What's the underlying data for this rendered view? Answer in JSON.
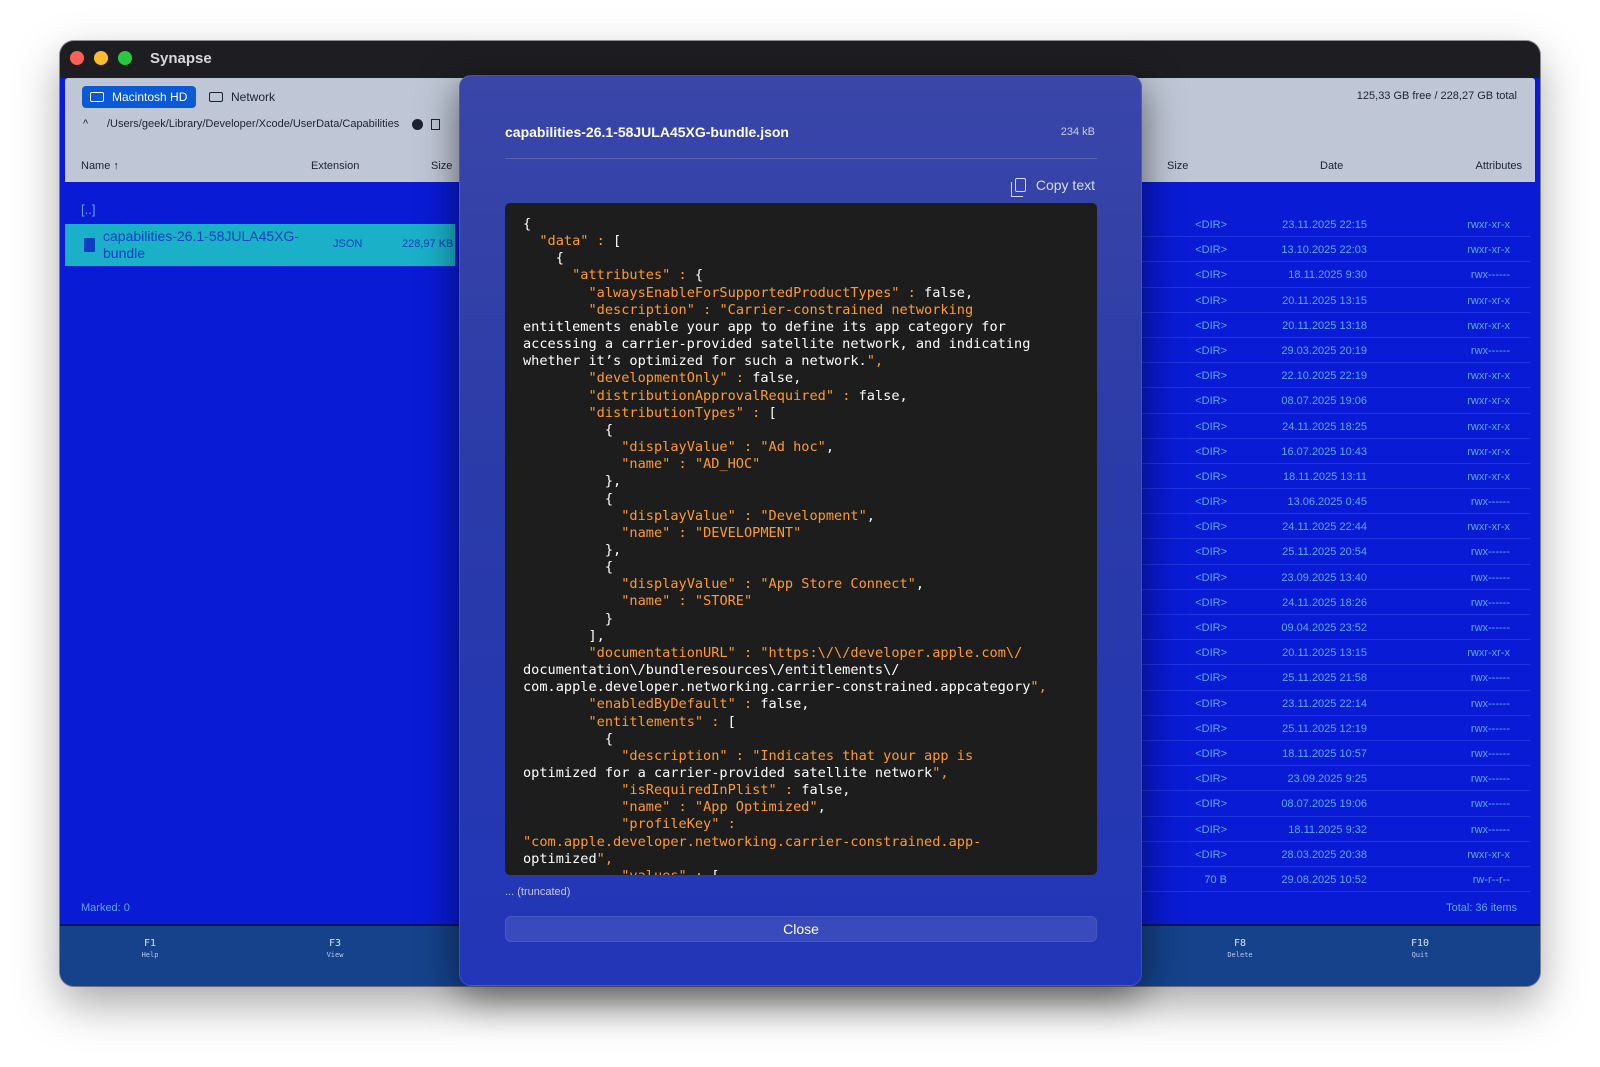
{
  "app": {
    "title": "Synapse"
  },
  "toolbar": {
    "volumes": [
      {
        "label": "Macintosh HD",
        "icon": "drive-icon"
      },
      {
        "label": "Network",
        "icon": "network-icon"
      }
    ],
    "free_space": "125,33 GB free / 228,27 GB total",
    "path": "/Users/geek/Library/Developer/Xcode/UserData/Capabilities"
  },
  "left_panel": {
    "columns": {
      "name": "Name ↑",
      "extension": "Extension",
      "size": "Size"
    },
    "parent": "[..]",
    "selected_file": {
      "name": "capabilities-26.1-58JULA45XG-bundle",
      "extension": "JSON",
      "size": "228,97 KB"
    },
    "marked": "Marked: 0"
  },
  "right_panel": {
    "columns": {
      "size": "Size",
      "date": "Date",
      "attributes": "Attributes"
    },
    "rows": [
      {
        "size": "<DIR>",
        "date": "23.11.2025 22:15",
        "attr": "rwxr-xr-x"
      },
      {
        "size": "<DIR>",
        "date": "13.10.2025 22:03",
        "attr": "rwxr-xr-x"
      },
      {
        "size": "<DIR>",
        "date": "18.11.2025 9:30",
        "attr": "rwx------"
      },
      {
        "size": "<DIR>",
        "date": "20.11.2025 13:15",
        "attr": "rwxr-xr-x"
      },
      {
        "size": "<DIR>",
        "date": "20.11.2025 13:18",
        "attr": "rwxr-xr-x"
      },
      {
        "size": "<DIR>",
        "date": "29.03.2025 20:19",
        "attr": "rwx------"
      },
      {
        "size": "<DIR>",
        "date": "22.10.2025 22:19",
        "attr": "rwxr-xr-x"
      },
      {
        "size": "<DIR>",
        "date": "08.07.2025 19:06",
        "attr": "rwxr-xr-x"
      },
      {
        "size": "<DIR>",
        "date": "24.11.2025 18:25",
        "attr": "rwxr-xr-x"
      },
      {
        "size": "<DIR>",
        "date": "16.07.2025 10:43",
        "attr": "rwxr-xr-x"
      },
      {
        "size": "<DIR>",
        "date": "18.11.2025 13:11",
        "attr": "rwxr-xr-x"
      },
      {
        "size": "<DIR>",
        "date": "13.06.2025 0:45",
        "attr": "rwx------"
      },
      {
        "size": "<DIR>",
        "date": "24.11.2025 22:44",
        "attr": "rwxr-xr-x"
      },
      {
        "size": "<DIR>",
        "date": "25.11.2025 20:54",
        "attr": "rwx------"
      },
      {
        "size": "<DIR>",
        "date": "23.09.2025 13:40",
        "attr": "rwx------"
      },
      {
        "size": "<DIR>",
        "date": "24.11.2025 18:26",
        "attr": "rwx------"
      },
      {
        "size": "<DIR>",
        "date": "09.04.2025 23:52",
        "attr": "rwx------"
      },
      {
        "size": "<DIR>",
        "date": "20.11.2025 13:15",
        "attr": "rwxr-xr-x"
      },
      {
        "size": "<DIR>",
        "date": "25.11.2025 21:58",
        "attr": "rwx------"
      },
      {
        "size": "<DIR>",
        "date": "23.11.2025 22:14",
        "attr": "rwx------"
      },
      {
        "size": "<DIR>",
        "date": "25.11.2025 12:19",
        "attr": "rwx------"
      },
      {
        "size": "<DIR>",
        "date": "18.11.2025 10:57",
        "attr": "rwx------"
      },
      {
        "size": "<DIR>",
        "date": "23.09.2025 9:25",
        "attr": "rwx------"
      },
      {
        "size": "<DIR>",
        "date": "08.07.2025 19:06",
        "attr": "rwx------"
      },
      {
        "size": "<DIR>",
        "date": "18.11.2025 9:32",
        "attr": "rwx------"
      },
      {
        "size": "<DIR>",
        "date": "28.03.2025 20:38",
        "attr": "rwxr-xr-x"
      },
      {
        "size": "70 B",
        "date": "29.08.2025 10:52",
        "attr": "rw-r--r--"
      }
    ],
    "total": "Total: 36 items"
  },
  "fkeys": [
    {
      "key": "F1",
      "label": "Help"
    },
    {
      "key": "F3",
      "label": "View"
    },
    {
      "key": "F8",
      "label": "Delete"
    },
    {
      "key": "F10",
      "label": "Quit"
    }
  ],
  "modal": {
    "title": "capabilities-26.1-58JULA45XG-bundle.json",
    "size": "234 kB",
    "copy_label": "Copy text",
    "truncated": "... (truncated)",
    "close_label": "Close",
    "json_lines": [
      "{",
      "  \"data\" : [",
      "    {",
      "      \"attributes\" : {",
      "        \"alwaysEnableForSupportedProductTypes\" : false,",
      "        \"description\" : \"Carrier-constrained networking",
      "entitlements enable your app to define its app category for",
      "accessing a carrier-provided satellite network, and indicating",
      "whether it’s optimized for such a network.\",",
      "        \"developmentOnly\" : false,",
      "        \"distributionApprovalRequired\" : false,",
      "        \"distributionTypes\" : [",
      "          {",
      "            \"displayValue\" : \"Ad hoc\",",
      "            \"name\" : \"AD_HOC\"",
      "          },",
      "          {",
      "            \"displayValue\" : \"Development\",",
      "            \"name\" : \"DEVELOPMENT\"",
      "          },",
      "          {",
      "            \"displayValue\" : \"App Store Connect\",",
      "            \"name\" : \"STORE\"",
      "          }",
      "        ],",
      "        \"documentationURL\" : \"https:\\/\\/developer.apple.com\\/",
      "documentation\\/bundleresources\\/entitlements\\/",
      "com.apple.developer.networking.carrier-constrained.appcategory\",",
      "        \"enabledByDefault\" : false,",
      "        \"entitlements\" : [",
      "          {",
      "            \"description\" : \"Indicates that your app is",
      "optimized for a carrier-provided satellite network\",",
      "            \"isRequiredInPlist\" : false,",
      "            \"name\" : \"App Optimized\",",
      "            \"profileKey\" :",
      "\"com.apple.developer.networking.carrier-constrained.app-",
      "optimized\",",
      "            \"values\" : ["
    ]
  }
}
